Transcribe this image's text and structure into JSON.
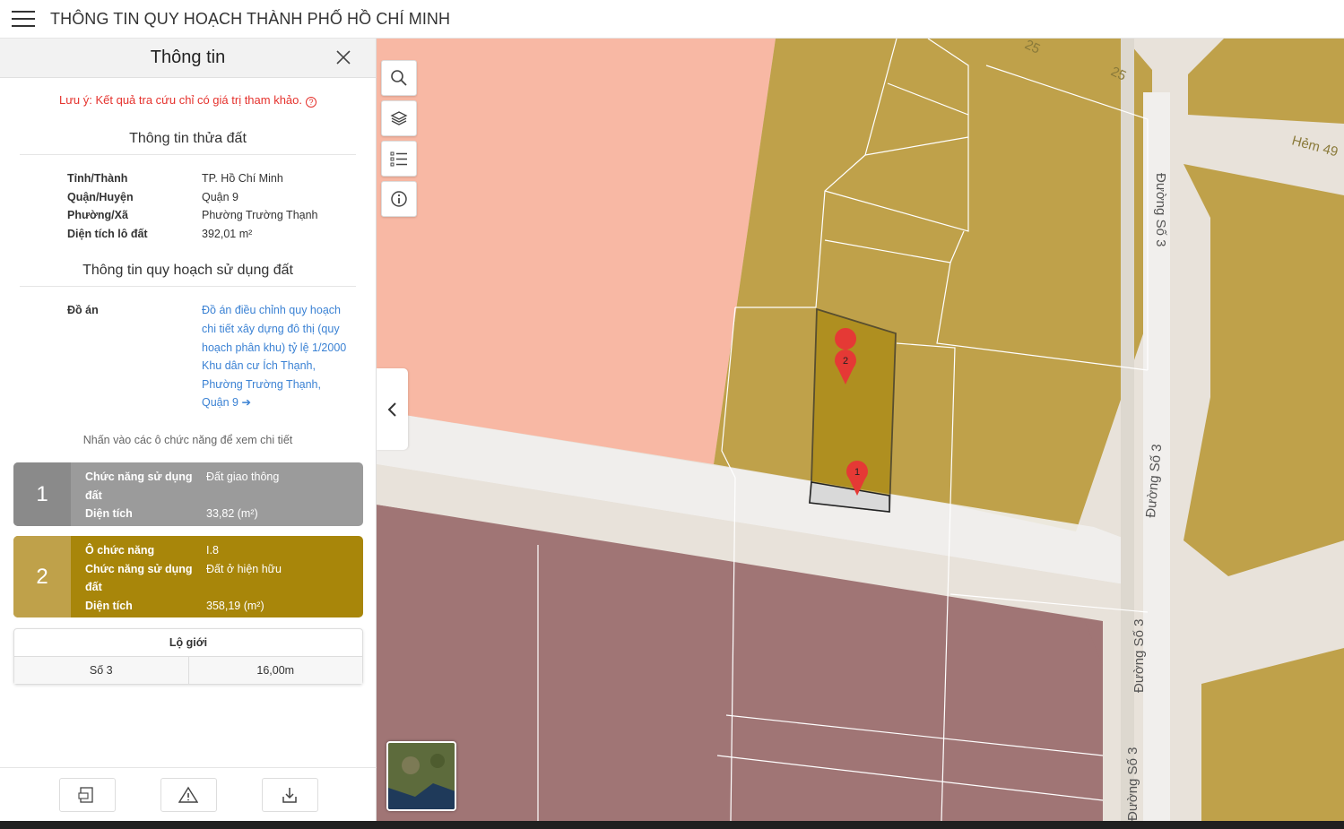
{
  "header": {
    "title": "THÔNG TIN QUY HOẠCH THÀNH PHỐ HỒ CHÍ MINH"
  },
  "panel": {
    "title": "Thông tin",
    "note": "Lưu ý: Kết quả tra cứu chỉ có giá trị tham khảo.",
    "parcel_section": "Thông tin thửa đất",
    "parcel": {
      "province_label": "Tỉnh/Thành",
      "province": "TP. Hồ Chí Minh",
      "district_label": "Quận/Huyện",
      "district": "Quận 9",
      "ward_label": "Phường/Xã",
      "ward": "Phường Trường Thạnh",
      "area_label": "Diện tích lô đất",
      "area": "392,01 m²"
    },
    "plan_section": "Thông tin quy hoạch sử dụng đất",
    "plan": {
      "project_label": "Đồ án",
      "project": "Đồ án điều chỉnh quy hoạch chi tiết xây dựng đô thị (quy hoạch phân khu) tỷ lệ 1/2000 Khu dân cư Ích Thạnh, Phường Trường Thạnh, Quận 9 ➔"
    },
    "hint": "Nhấn vào các ô chức năng để xem chi tiết",
    "cards": [
      {
        "num": "1",
        "func_label": "Chức năng sử dụng đất",
        "func": "Đất giao thông",
        "area_label": "Diện tích",
        "area": "33,82 (m²)"
      },
      {
        "num": "2",
        "cell_label": "Ô chức năng",
        "cell": "I.8",
        "func_label": "Chức năng sử dụng đất",
        "func": "Đất ở hiện hữu",
        "area_label": "Diện tích",
        "area": "358,19 (m²)"
      }
    ],
    "road": {
      "title": "Lộ giới",
      "name": "Số 3",
      "width": "16,00m"
    }
  },
  "map": {
    "labels": {
      "road_v1": "Đường Số 3",
      "road_v2": "Đường Số 3",
      "road_v3": "Đường Số 3",
      "road_v4": "Đường Số 3",
      "alley": "Hẻm 49",
      "n25a": "25",
      "n25b": "25"
    },
    "markers": [
      "1",
      "2"
    ],
    "colors": {
      "residential": "#bfa14a",
      "pink": "#f8b8a4",
      "mauve": "#a07575",
      "road": "#e8e2da"
    }
  }
}
